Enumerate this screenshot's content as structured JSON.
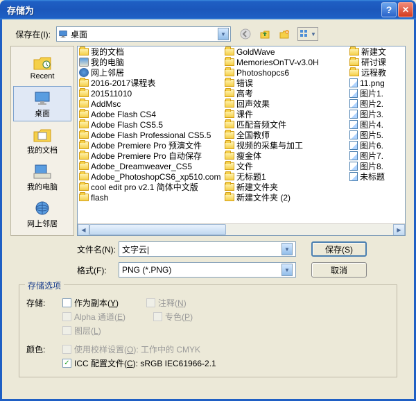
{
  "title": "存储为",
  "lookin_label": "保存在(I):",
  "lookin_value": "桌面",
  "places": [
    {
      "label": "Recent"
    },
    {
      "label": "桌面"
    },
    {
      "label": "我的文档"
    },
    {
      "label": "我的电脑"
    },
    {
      "label": "网上邻居"
    }
  ],
  "file_cols": [
    [
      {
        "t": "folder-special",
        "n": "我的文档"
      },
      {
        "t": "computer",
        "n": "我的电脑"
      },
      {
        "t": "network",
        "n": "网上邻居"
      },
      {
        "t": "folder",
        "n": "2016-2017课程表"
      },
      {
        "t": "folder",
        "n": "201511010"
      },
      {
        "t": "folder",
        "n": "AddMsc"
      },
      {
        "t": "folder",
        "n": "Adobe Flash CS4"
      },
      {
        "t": "folder",
        "n": "Adobe Flash CS5.5"
      },
      {
        "t": "folder",
        "n": "Adobe Flash Professional CS5.5"
      },
      {
        "t": "folder",
        "n": "Adobe Premiere Pro 预演文件"
      },
      {
        "t": "folder",
        "n": "Adobe Premiere Pro 自动保存"
      },
      {
        "t": "folder",
        "n": "Adobe_Dreamweaver_CS5"
      },
      {
        "t": "folder",
        "n": "Adobe_PhotoshopCS6_xp510.com"
      },
      {
        "t": "folder",
        "n": "cool edit pro v2.1 简体中文版"
      },
      {
        "t": "folder",
        "n": "flash"
      }
    ],
    [
      {
        "t": "folder",
        "n": "GoldWave"
      },
      {
        "t": "folder",
        "n": "MemoriesOnTV-v3.0H"
      },
      {
        "t": "folder",
        "n": "Photoshopcs6"
      },
      {
        "t": "folder",
        "n": "错误"
      },
      {
        "t": "folder",
        "n": "高考"
      },
      {
        "t": "folder",
        "n": "回声效果"
      },
      {
        "t": "folder",
        "n": "课件"
      },
      {
        "t": "folder",
        "n": "匹配音频文件"
      },
      {
        "t": "folder",
        "n": "全国教师"
      },
      {
        "t": "folder",
        "n": "视频的采集与加工"
      },
      {
        "t": "folder",
        "n": "瘦金体"
      },
      {
        "t": "folder",
        "n": "文件"
      },
      {
        "t": "folder",
        "n": "无标题1"
      },
      {
        "t": "folder",
        "n": "新建文件夹"
      },
      {
        "t": "folder",
        "n": "新建文件夹 (2)"
      }
    ],
    [
      {
        "t": "folder",
        "n": "新建文"
      },
      {
        "t": "folder",
        "n": "研讨课"
      },
      {
        "t": "folder",
        "n": "远程教"
      },
      {
        "t": "png",
        "n": "11.png"
      },
      {
        "t": "png",
        "n": "图片1."
      },
      {
        "t": "png",
        "n": "图片2."
      },
      {
        "t": "png",
        "n": "图片3."
      },
      {
        "t": "png",
        "n": "图片4."
      },
      {
        "t": "png",
        "n": "图片5."
      },
      {
        "t": "png",
        "n": "图片6."
      },
      {
        "t": "png",
        "n": "图片7."
      },
      {
        "t": "png",
        "n": "图片8."
      },
      {
        "t": "png",
        "n": "未标题"
      }
    ]
  ],
  "filename_label": "文件名(N):",
  "filename_value": "文字云|",
  "format_label": "格式(F):",
  "format_value": "PNG (*.PNG)",
  "save_btn": "保存(S)",
  "cancel_btn": "取消",
  "group_title": "存储选项",
  "store_label": "存储:",
  "color_label": "颜色:",
  "opts": {
    "as_copy": "作为副本(Y)",
    "notes": "注释(N)",
    "alpha": "Alpha 通道(E)",
    "spot": "专色(P)",
    "layers": "图层(L)",
    "proof": "使用校样设置(O): 工作中的 CMYK",
    "icc": "ICC 配置文件(C): sRGB IEC61966-2.1"
  }
}
